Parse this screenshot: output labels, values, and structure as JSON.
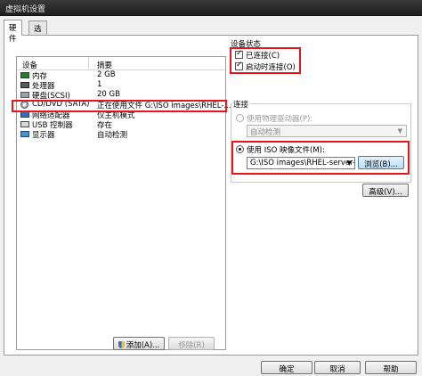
{
  "window": {
    "title": "虚拟机设置"
  },
  "tabs": [
    {
      "label": "硬件"
    },
    {
      "label": "选项"
    }
  ],
  "device_list": {
    "headers": {
      "device": "设备",
      "summary": "摘要"
    },
    "rows": [
      {
        "icon": "memory-icon",
        "name": "内存",
        "summary": "2 GB"
      },
      {
        "icon": "cpu-icon",
        "name": "处理器",
        "summary": "1"
      },
      {
        "icon": "hard-disk-icon",
        "name": "硬盘(SCSI)",
        "summary": "20 GB"
      },
      {
        "icon": "cd-dvd-icon",
        "name": "CD/DVD (SATA)",
        "summary": "正在使用文件 G:\\ISO images\\RHEL-..."
      },
      {
        "icon": "network-adapter-icon",
        "name": "网络适配器",
        "summary": "仅主机模式"
      },
      {
        "icon": "usb-icon",
        "name": "USB 控制器",
        "summary": "存在"
      },
      {
        "icon": "display-icon",
        "name": "显示器",
        "summary": "自动检测"
      }
    ],
    "add_button": "添加(A)...",
    "remove_button": "移除(R)"
  },
  "device_status": {
    "title": "设备状态",
    "connected": {
      "label": "已连接(C)",
      "checked": true
    },
    "connect_at_power_on": {
      "label": "启动时连接(O)",
      "checked": true
    }
  },
  "connection": {
    "title": "连接",
    "physical_drive": {
      "label": "使用物理驱动器(P):",
      "selected": false,
      "value": "自动检测"
    },
    "iso_image": {
      "label": "使用 ISO 映像文件(M):",
      "selected": true,
      "value": "G:\\ISO images\\RHEL-server-",
      "browse_button": "浏览(B)..."
    },
    "advanced_button": "高级(V)..."
  },
  "footer": {
    "ok": "确定",
    "cancel": "取消",
    "help": "帮助"
  },
  "colors": {
    "highlight_box": "#e8141b",
    "primary_button_border": "#3c7fb1"
  }
}
